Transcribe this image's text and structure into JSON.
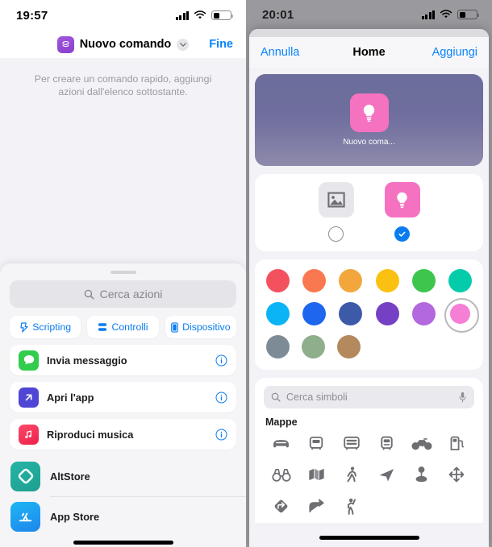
{
  "left_screen": {
    "status_bar": {
      "time": "19:57",
      "signal_icon": "cellular-bars-icon",
      "wifi_icon": "wifi-icon",
      "battery_icon": "battery-low-icon"
    },
    "nav": {
      "app_badge_icon": "shortcuts-app-icon",
      "title": "Nuovo comando",
      "chevron_icon": "chevron-down-icon",
      "done_label": "Fine"
    },
    "hint_text": "Per creare un comando rapido, aggiungi azioni dall'elenco sottostante.",
    "sheet": {
      "grabber_icon": "sheet-grabber",
      "search": {
        "placeholder": "Cerca azioni",
        "icon": "search-icon"
      },
      "chips": [
        {
          "label": "Scripting",
          "icon": "scripting-icon"
        },
        {
          "label": "Controlli",
          "icon": "controls-icon"
        },
        {
          "label": "Dispositivo",
          "icon": "device-icon"
        }
      ],
      "actions": [
        {
          "label": "Invia messaggio",
          "icon": "messages-icon",
          "color": "#32cd4d",
          "info_icon": "info-circle-icon"
        },
        {
          "label": "Apri l'app",
          "icon": "open-app-arrow-icon",
          "color": "#4f46d6",
          "info_icon": "info-circle-icon"
        },
        {
          "label": "Riproduci musica",
          "icon": "music-note-icon",
          "color": "#f4305a",
          "info_icon": "info-circle-icon"
        }
      ],
      "apps": [
        {
          "label": "AltStore",
          "icon": "altstore-icon"
        },
        {
          "label": "App Store",
          "icon": "app-store-icon"
        }
      ]
    }
  },
  "right_screen": {
    "status_bar": {
      "time": "20:01",
      "signal_icon": "cellular-bars-icon",
      "wifi_icon": "wifi-icon",
      "battery_icon": "battery-low-icon"
    },
    "modal": {
      "cancel_label": "Annulla",
      "title": "Home",
      "add_label": "Aggiungi",
      "preview": {
        "label": "Nuovo coma...",
        "glyph_icon": "lightbulb-icon",
        "glyph_bg": "#f472c0"
      },
      "glyph_options": [
        {
          "name": "photo-option",
          "icon": "photo-icon",
          "selected": false
        },
        {
          "name": "bulb-option",
          "icon": "lightbulb-icon",
          "selected": true
        }
      ],
      "colors": {
        "row1": [
          "#f4515e",
          "#fa7850",
          "#f2a63c",
          "#fbc112",
          "#3cc64e",
          "#04ccaa"
        ],
        "row2": [
          "#0ab4f5",
          "#1f66ef",
          "#3d5aa9",
          "#7540c4",
          "#b368e0",
          "#f57fd4"
        ],
        "row3": [
          "#7d8b96",
          "#8fae8b",
          "#b4895d"
        ],
        "selected_index_row": 2,
        "selected_index_col": 6,
        "selected_hex": "#f57fd4",
        "selection_ring": "#b9b9bd"
      },
      "symbols": {
        "search": {
          "placeholder": "Cerca simboli",
          "icon": "search-icon",
          "mic_icon": "microphone-icon"
        },
        "group_title": "Mappe",
        "icons_row1": [
          "car-icon",
          "bus-icon",
          "bus-doubledecker-icon",
          "tram-icon",
          "bicycle-icon",
          "fuelpump-icon"
        ],
        "icons_row2": [
          "binoculars-icon",
          "map-icon",
          "figure-walk-icon",
          "location-north-icon",
          "mappin-and-ellipse-icon",
          "arrow-up-down-left-right-icon"
        ],
        "icons_row3": [
          "arrow-turn-up-right-diamond-icon",
          "arrow-turn-up-right-icon",
          "figure-wave-icon"
        ]
      }
    }
  }
}
